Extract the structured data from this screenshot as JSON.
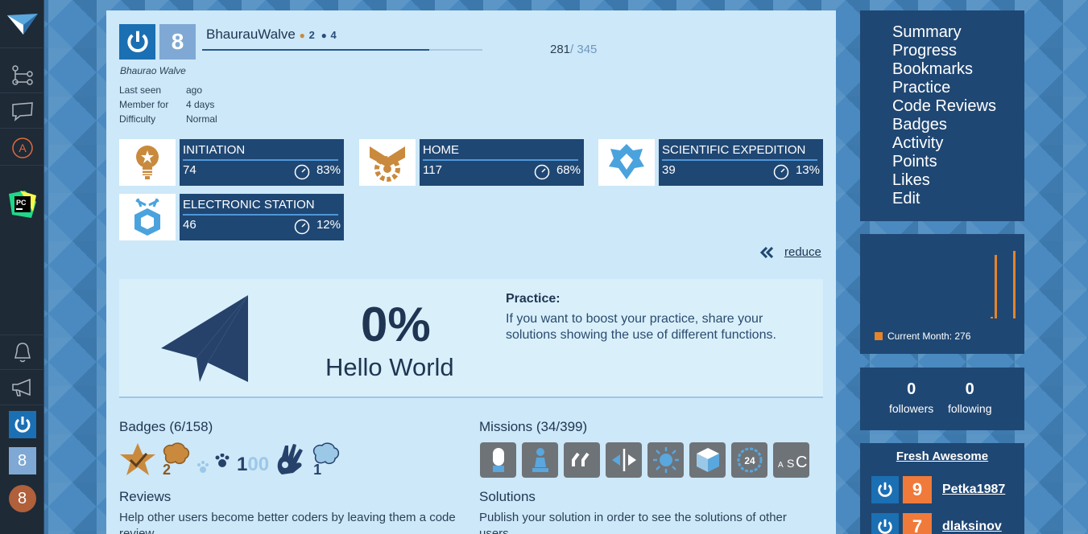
{
  "sidebar": {
    "items": [
      "logo-icon",
      "tree-icon",
      "chat-icon",
      "a-circle-icon",
      "pycharm-icon",
      "bell-icon",
      "megaphone-icon",
      "power-avatar",
      "level-badge",
      "profile-badge"
    ],
    "level_label": "8",
    "profile_label": "8"
  },
  "profile": {
    "level": "8",
    "username": "BhaurauWalve",
    "dot1": "●",
    "num1": "2",
    "dot2": "●",
    "num2": "4",
    "xp_current": "281",
    "xp_total": "/ 345",
    "xp_fraction": 0.81,
    "full_name": "Bhaurao Walve",
    "last_seen_label": "Last seen",
    "last_seen_value": "ago",
    "member_label": "Member for",
    "member_value": "4 days",
    "difficulty_label": "Difficulty",
    "difficulty_value": "Normal"
  },
  "stations": [
    {
      "title": "INITIATION",
      "count": "74",
      "percent": "83%",
      "progress": 0.83
    },
    {
      "title": "HOME",
      "count": "117",
      "percent": "68%",
      "progress": 0.68
    },
    {
      "title": "SCIENTIFIC EXPEDITION",
      "count": "39",
      "percent": "13%",
      "progress": 0.13
    },
    {
      "title": "ELECTRONIC STATION",
      "count": "46",
      "percent": "12%",
      "progress": 0.12
    }
  ],
  "reduce_label": "reduce",
  "practice": {
    "percent": "0%",
    "mission": "Hello World",
    "title": "Practice:",
    "text": "If you want to boost your practice, share your solutions showing the use of different functions."
  },
  "badges": {
    "title": "Badges (6/158)",
    "count2": "2",
    "count100": "1",
    "count100b": "00",
    "count1": "1"
  },
  "missions": {
    "title": "Missions (34/399)"
  },
  "reviews": {
    "title": "Reviews",
    "text": "Help other users become better coders by leaving them a code review"
  },
  "solutions": {
    "title": "Solutions",
    "text": "Publish your solution in order to see the solutions of other users"
  },
  "nav": [
    "Summary",
    "Progress",
    "Bookmarks",
    "Practice",
    "Code Reviews",
    "Badges",
    "Activity",
    "Points",
    "Likes",
    "Edit"
  ],
  "chart_data": {
    "type": "bar",
    "series": [
      {
        "name": "Current Month: 276",
        "values": [
          2,
          88,
          93
        ]
      }
    ],
    "legend": "Current Month: 276"
  },
  "follow": {
    "followers_count": "0",
    "followers_label": "followers",
    "following_count": "0",
    "following_label": "following"
  },
  "fresh": {
    "title": "Fresh Awesome",
    "users": [
      {
        "level": "9",
        "name": "Petka1987"
      },
      {
        "level": "7",
        "name": "dlaksinov"
      }
    ]
  },
  "colors": {
    "navy": "#1f4773",
    "accent_blue": "#1b6fb3",
    "orange": "#e5842b",
    "panel": "#cde8f8"
  }
}
